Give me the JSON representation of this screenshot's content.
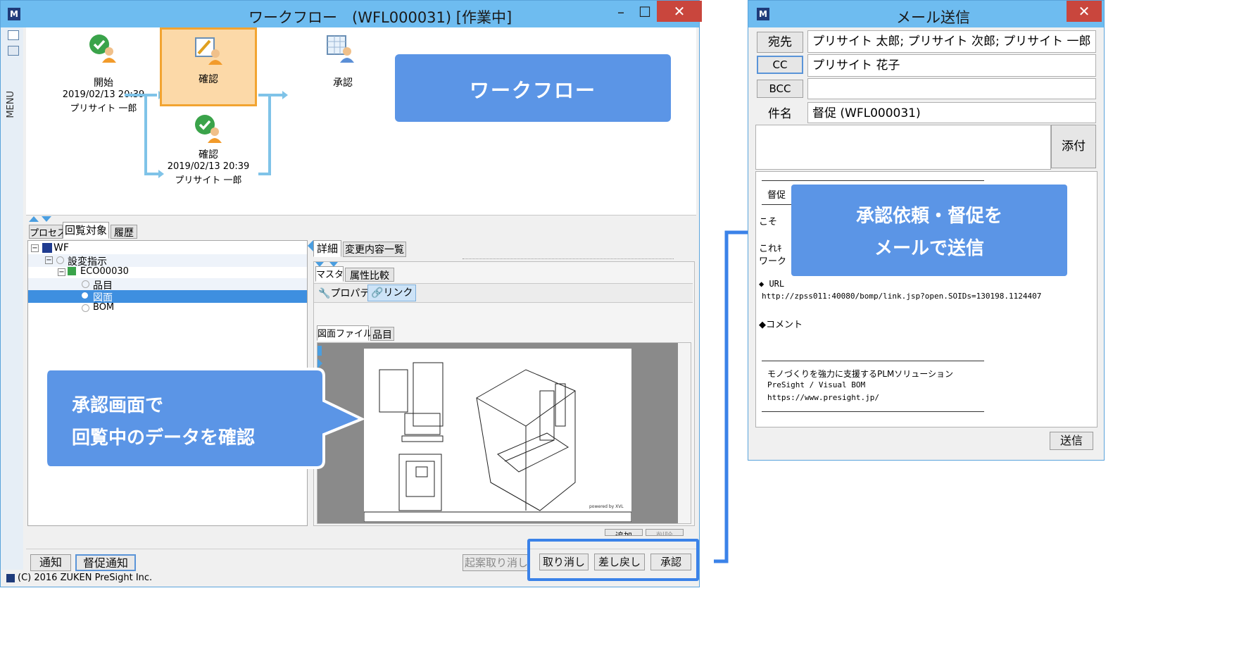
{
  "workflow_window": {
    "title": "ワークフロー　(WFL000031) [作業中]",
    "close_glyph": "✕",
    "minimize_glyph": "–",
    "maximize_glyph": "☐",
    "menu_label": "MENU",
    "nodes": [
      {
        "label": "開始",
        "date": "2019/02/13 20:39",
        "user": "プリサイト 一郎"
      },
      {
        "label": "確認",
        "date": "",
        "user": ""
      },
      {
        "label": "承認",
        "date": "",
        "user": ""
      },
      {
        "label": "確認",
        "date": "2019/02/13 20:39",
        "user": "プリサイト 一郎"
      }
    ],
    "tabs": [
      "プロセス",
      "回覧対象",
      "履歴"
    ],
    "tree": [
      {
        "label": "WF"
      },
      {
        "label": "設変指示"
      },
      {
        "label": "ECO00030"
      },
      {
        "label": "品目"
      },
      {
        "label": "図面"
      },
      {
        "label": "BOM"
      }
    ],
    "detail_tabs": [
      "詳細",
      "変更内容一覧"
    ],
    "sub_tabs": [
      "マスタ",
      "属性比較"
    ],
    "prop_tabs": [
      "プロパティ",
      "リンク"
    ],
    "file_tabs": [
      "図面ファイル",
      "品目"
    ],
    "drawing_credit": "powered by XVL",
    "bottom_left_buttons": [
      "通知",
      "督促通知"
    ],
    "cancel_start_label": "起案取り消し",
    "action_buttons": [
      "取り消し",
      "差し戻し",
      "承認"
    ],
    "hidden_buttons": [
      "追加",
      "削除"
    ],
    "copyright": "(C) 2016 ZUKEN PreSight Inc."
  },
  "callouts": {
    "workflow": "ワークフロー",
    "confirm_line1": "承認画面で",
    "confirm_line2": "回覧中のデータを確認",
    "mail_line1": "承認依頼・督促を",
    "mail_line2": "メールで送信"
  },
  "mail_window": {
    "title": "メール送信",
    "close_glyph": "✕",
    "to_label": "宛先",
    "to_value": "プリサイト 太郎; プリサイト 次郎; プリサイト 一郎",
    "cc_label": "CC",
    "cc_value": "プリサイト 花子",
    "bcc_label": "BCC",
    "bcc_value": "",
    "subject_label": "件名",
    "subject_value": "督促 (WFL000031)",
    "attach_label": "添付",
    "body_tab": "督促",
    "body_frag1": "こそ",
    "body_frag2": "これｷ",
    "body_frag3": "ワーク",
    "url_heading": "◆ URL",
    "url": "http://zpss011:40080/bomp/link.jsp?open.SOIDs=130198.1124407",
    "comment_heading": "◆コメント",
    "footer1": "モノづくりを強力に支援するPLMソリューション",
    "footer2": "PreSight / Visual BOM",
    "footer3": "https://www.presight.jp/",
    "send_label": "送信"
  },
  "colors": {
    "titlebar": "#6ebcf0",
    "close": "#c9463d",
    "callout": "#5b95e6",
    "highlight_frame": "#3b82e8",
    "selected_node_bg": "#fcd9a8",
    "selected_node_border": "#f2a431",
    "arrow": "#7fc3e8",
    "tree_selected": "#3e8fe0"
  }
}
